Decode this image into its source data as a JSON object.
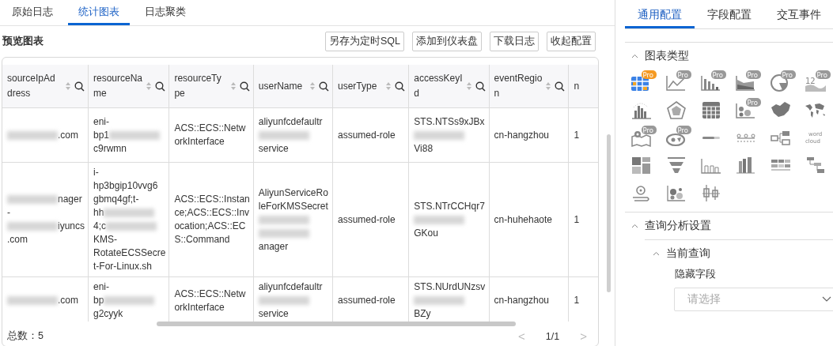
{
  "tabs": [
    {
      "label": "原始日志",
      "selected": false
    },
    {
      "label": "统计图表",
      "selected": true
    },
    {
      "label": "日志聚类",
      "selected": false
    }
  ],
  "preview": {
    "title": "预览图表",
    "buttons": [
      "另存为定时SQL",
      "添加到仪表盘",
      "下载日志",
      "收起配置"
    ]
  },
  "table": {
    "columns": [
      {
        "lines": [
          "sourceIpAd",
          "dress"
        ],
        "sortable": true,
        "searchable": true
      },
      {
        "lines": [
          "resourceNa",
          "me"
        ],
        "sortable": true,
        "searchable": true
      },
      {
        "lines": [
          "resourceTy",
          "pe"
        ],
        "sortable": true,
        "searchable": true
      },
      {
        "lines": [
          "userName"
        ],
        "sortable": true,
        "searchable": true
      },
      {
        "lines": [
          "userType"
        ],
        "sortable": true,
        "searchable": true
      },
      {
        "lines": [
          "accessKeyI",
          "d"
        ],
        "sortable": true,
        "searchable": true
      },
      {
        "lines": [
          "eventRegio",
          "n"
        ],
        "sortable": true,
        "searchable": true
      },
      {
        "lines": [
          "n"
        ],
        "sortable": false,
        "searchable": false
      }
    ],
    "rows": [
      [
        [
          [
            {
              "kind": "redacted"
            },
            {
              "kind": "text",
              "text": ".com"
            }
          ]
        ],
        [
          [
            {
              "kind": "text",
              "text": "eni-"
            }
          ],
          [
            {
              "kind": "text",
              "text": "bp1"
            },
            {
              "kind": "redacted"
            }
          ],
          [
            {
              "kind": "text",
              "text": "c9rwmn"
            }
          ]
        ],
        [
          [
            {
              "kind": "text",
              "text": "ACS::ECS::Netw"
            }
          ],
          [
            {
              "kind": "text",
              "text": "orkInterface"
            }
          ]
        ],
        [
          [
            {
              "kind": "text",
              "text": "aliyunfcdefaultr"
            }
          ],
          [
            {
              "kind": "redacted"
            }
          ],
          [
            {
              "kind": "text",
              "text": "service"
            }
          ]
        ],
        [
          [
            {
              "kind": "text",
              "text": "assumed-role"
            }
          ]
        ],
        [
          [
            {
              "kind": "text",
              "text": "STS.NTSs9xJBx"
            }
          ],
          [
            {
              "kind": "redacted"
            }
          ],
          [
            {
              "kind": "text",
              "text": "Vi88"
            }
          ]
        ],
        [
          [
            {
              "kind": "text",
              "text": "cn-hangzhou"
            }
          ]
        ],
        [
          [
            {
              "kind": "text",
              "text": "1"
            }
          ]
        ]
      ],
      [
        [
          [
            {
              "kind": "redacted"
            },
            {
              "kind": "text",
              "text": "nager"
            }
          ],
          [
            {
              "kind": "text",
              "text": "-"
            }
          ],
          [
            {
              "kind": "redacted"
            },
            {
              "kind": "text",
              "text": "iyuncs"
            }
          ],
          [
            {
              "kind": "text",
              "text": ".com"
            }
          ]
        ],
        [
          [
            {
              "kind": "text",
              "text": "i-"
            }
          ],
          [
            {
              "kind": "text",
              "text": "hp3bgip10vvg6"
            }
          ],
          [
            {
              "kind": "text",
              "text": "gbmq4gf;t-"
            }
          ],
          [
            {
              "kind": "text",
              "text": "hh"
            },
            {
              "kind": "redacted"
            }
          ],
          [
            {
              "kind": "text",
              "text": "4;c"
            },
            {
              "kind": "redacted"
            }
          ],
          [
            {
              "kind": "text",
              "text": "KMS-"
            }
          ],
          [
            {
              "kind": "text",
              "text": "RotateECSSecre"
            }
          ],
          [
            {
              "kind": "text",
              "text": "t-For-Linux.sh"
            }
          ]
        ],
        [
          [
            {
              "kind": "text",
              "text": "ACS::ECS::Instan"
            }
          ],
          [
            {
              "kind": "text",
              "text": "ce;ACS::ECS::Inv"
            }
          ],
          [
            {
              "kind": "text",
              "text": "ocation;ACS::EC"
            }
          ],
          [
            {
              "kind": "text",
              "text": "S::Command"
            }
          ]
        ],
        [
          [
            {
              "kind": "text",
              "text": "AliyunServiceRo"
            }
          ],
          [
            {
              "kind": "text",
              "text": "leForKMSSecret"
            }
          ],
          [
            {
              "kind": "redacted"
            }
          ],
          [
            {
              "kind": "redacted"
            }
          ],
          [
            {
              "kind": "text",
              "text": "anager"
            }
          ]
        ],
        [
          [
            {
              "kind": "text",
              "text": "assumed-role"
            }
          ]
        ],
        [
          [
            {
              "kind": "text",
              "text": "STS.NTrCCHqr7"
            }
          ],
          [
            {
              "kind": "redacted"
            }
          ],
          [
            {
              "kind": "text",
              "text": "GKou"
            }
          ]
        ],
        [
          [
            {
              "kind": "text",
              "text": "cn-huhehaote"
            }
          ]
        ],
        [
          [
            {
              "kind": "text",
              "text": "1"
            }
          ]
        ]
      ],
      [
        [
          [
            {
              "kind": "redacted"
            },
            {
              "kind": "text",
              "text": ".com"
            }
          ]
        ],
        [
          [
            {
              "kind": "text",
              "text": "eni-"
            }
          ],
          [
            {
              "kind": "text",
              "text": "bp"
            },
            {
              "kind": "redacted"
            }
          ],
          [
            {
              "kind": "text",
              "text": "g2cyyk"
            }
          ]
        ],
        [
          [
            {
              "kind": "text",
              "text": "ACS::ECS::Netw"
            }
          ],
          [
            {
              "kind": "text",
              "text": "orkInterface"
            }
          ]
        ],
        [
          [
            {
              "kind": "text",
              "text": "aliyunfcdefaultr"
            }
          ],
          [
            {
              "kind": "redacted"
            }
          ],
          [
            {
              "kind": "text",
              "text": "service"
            }
          ]
        ],
        [
          [
            {
              "kind": "text",
              "text": "assumed-role"
            }
          ]
        ],
        [
          [
            {
              "kind": "text",
              "text": "STS.NUrdUNzsv"
            }
          ],
          [
            {
              "kind": "redacted"
            }
          ],
          [
            {
              "kind": "text",
              "text": "BZy"
            }
          ]
        ],
        [
          [
            {
              "kind": "text",
              "text": "cn-hangzhou"
            }
          ]
        ],
        [
          [
            {
              "kind": "text",
              "text": "1"
            }
          ]
        ]
      ]
    ]
  },
  "footer": {
    "total": "总数：5",
    "prev": "<",
    "page": "1/1",
    "next": ">"
  },
  "config": {
    "tabs": [
      {
        "label": "通用配置",
        "selected": true
      },
      {
        "label": "字段配置",
        "selected": false
      },
      {
        "label": "交互事件",
        "selected": false
      }
    ],
    "chart_section": {
      "title": "图表类型",
      "expanded": true
    },
    "chart_types": [
      {
        "kind": "table",
        "selected": true,
        "badge": "Pro"
      },
      {
        "kind": "line",
        "selected": false,
        "badge": "Pro"
      },
      {
        "kind": "bar",
        "selected": false,
        "badge": "Pro"
      },
      {
        "kind": "area",
        "selected": false,
        "badge": "Pro"
      },
      {
        "kind": "pie",
        "selected": false,
        "badge": "Pro"
      },
      {
        "kind": "number",
        "selected": false,
        "badge": "Pro",
        "label": "12"
      },
      {
        "kind": "histogram",
        "selected": false
      },
      {
        "kind": "radar",
        "selected": false
      },
      {
        "kind": "grid",
        "selected": false
      },
      {
        "kind": "scatter",
        "selected": false,
        "badge": "Pro"
      },
      {
        "kind": "country-map",
        "selected": false
      },
      {
        "kind": "world-map",
        "selected": false
      },
      {
        "kind": "pin-map",
        "selected": false,
        "badge": "Pro"
      },
      {
        "kind": "blob",
        "selected": false,
        "badge": "Pro"
      },
      {
        "kind": "progress",
        "selected": false
      },
      {
        "kind": "dots",
        "selected": false
      },
      {
        "kind": "flow",
        "selected": false
      },
      {
        "kind": "wordcloud",
        "selected": false,
        "label": "word",
        "label2": "cloud"
      },
      {
        "kind": "treemap",
        "selected": false
      },
      {
        "kind": "funnel",
        "selected": false
      },
      {
        "kind": "bar-outline",
        "selected": false
      },
      {
        "kind": "columns",
        "selected": false
      },
      {
        "kind": "blocks",
        "selected": false
      },
      {
        "kind": "tree",
        "selected": false
      },
      {
        "kind": "location",
        "selected": false
      },
      {
        "kind": "bubble",
        "selected": false
      },
      {
        "kind": "candle",
        "selected": false
      }
    ],
    "query_section": {
      "title": "查询分析设置",
      "expanded": true
    },
    "current_query": {
      "title": "当前查询",
      "expanded": true
    },
    "hidden_fields": {
      "label": "隐藏字段",
      "placeholder": "请选择"
    }
  }
}
